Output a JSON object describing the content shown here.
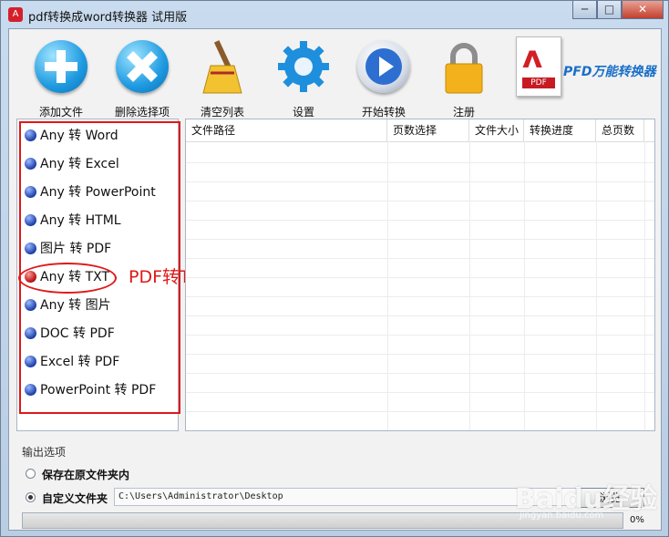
{
  "window": {
    "title": "pdf转换成word转换器 试用版",
    "minimize": "─",
    "maximize": "□",
    "close": "✕"
  },
  "toolbar": [
    {
      "label": "添加文件",
      "icon": "plus-icon"
    },
    {
      "label": "删除选择项",
      "icon": "x-icon"
    },
    {
      "label": "清空列表",
      "icon": "broom-icon"
    },
    {
      "label": "设置",
      "icon": "gear-icon"
    },
    {
      "label": "开始转换",
      "icon": "play-icon"
    },
    {
      "label": "注册",
      "icon": "lock-icon"
    }
  ],
  "brand": {
    "doc_tag": "PDF",
    "text": "PFD万能转换器"
  },
  "conversions": [
    {
      "label": "Any 转 Word",
      "selected": false
    },
    {
      "label": "Any 转 Excel",
      "selected": false
    },
    {
      "label": "Any 转 PowerPoint",
      "selected": false
    },
    {
      "label": "Any 转 HTML",
      "selected": false
    },
    {
      "label": "图片 转 PDF",
      "selected": false
    },
    {
      "label": "Any 转 TXT",
      "selected": true
    },
    {
      "label": "Any 转 图片",
      "selected": false
    },
    {
      "label": "DOC 转 PDF",
      "selected": false
    },
    {
      "label": "Excel 转 PDF",
      "selected": false
    },
    {
      "label": "PowerPoint 转 PDF",
      "selected": false
    }
  ],
  "annotation": "PDF转TXT",
  "table": {
    "columns": [
      "文件路径",
      "页数选择",
      "文件大小",
      "转换进度",
      "总页数"
    ],
    "rows": []
  },
  "output": {
    "title": "输出选项",
    "option_original": "保存在原文件夹内",
    "option_custom": "自定义文件夹",
    "selected": "custom",
    "path": "C:\\Users\\Administrator\\Desktop",
    "browse": "浏览"
  },
  "progress": {
    "percent": 0,
    "label": "0%"
  },
  "watermark": {
    "logo": "Baidu经验",
    "url": "jingyan.baidu.com"
  }
}
